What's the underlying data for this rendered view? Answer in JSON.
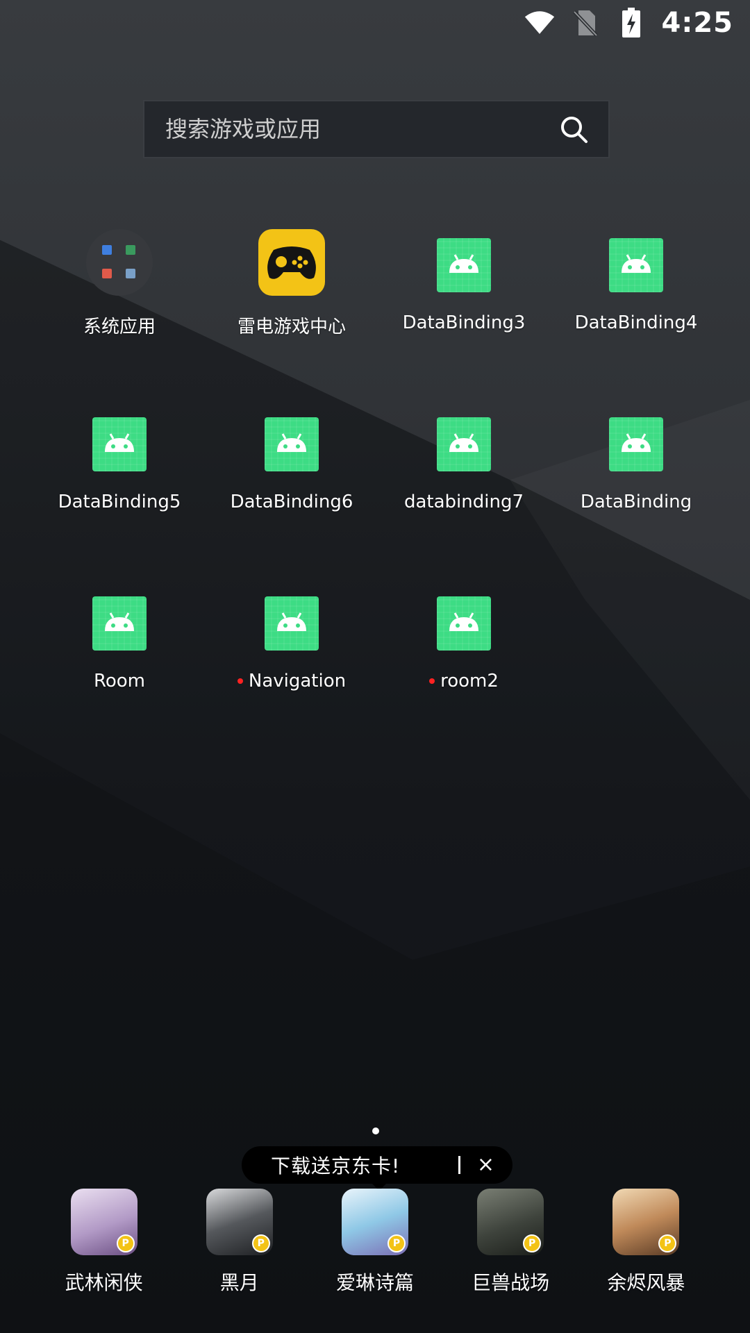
{
  "status_bar": {
    "time": "4:25",
    "icons": [
      "wifi-icon",
      "no-sim-icon",
      "battery-charging-icon"
    ]
  },
  "search": {
    "placeholder": "搜索游戏或应用",
    "icon": "search-icon"
  },
  "apps": [
    {
      "label": "系统应用",
      "icon": "folder-icon",
      "new": false
    },
    {
      "label": "雷电游戏中心",
      "icon": "gamepad-icon",
      "new": false
    },
    {
      "label": "DataBinding3",
      "icon": "android-icon",
      "new": false
    },
    {
      "label": "DataBinding4",
      "icon": "android-icon",
      "new": false
    },
    {
      "label": "DataBinding5",
      "icon": "android-icon",
      "new": false
    },
    {
      "label": "DataBinding6",
      "icon": "android-icon",
      "new": false
    },
    {
      "label": "databinding7",
      "icon": "android-icon",
      "new": false
    },
    {
      "label": "DataBinding",
      "icon": "android-icon",
      "new": false
    },
    {
      "label": "Room",
      "icon": "android-icon",
      "new": false
    },
    {
      "label": "Navigation",
      "icon": "android-icon",
      "new": true
    },
    {
      "label": "room2",
      "icon": "android-icon",
      "new": true
    }
  ],
  "promo": {
    "text": "下载送京东卡!",
    "close": "×"
  },
  "dock": [
    {
      "label": "武林闲侠",
      "color": "#c9b8d8"
    },
    {
      "label": "黑月",
      "color": "#6a6c70"
    },
    {
      "label": "爱琳诗篇",
      "color": "#a6d3e8"
    },
    {
      "label": "巨兽战场",
      "color": "#4a4f46"
    },
    {
      "label": "余烬风暴",
      "color": "#c08a5a"
    }
  ],
  "colors": {
    "android_green": "#3ddc84",
    "game_center_yellow": "#f3c316",
    "new_dot": "#ff2222"
  }
}
